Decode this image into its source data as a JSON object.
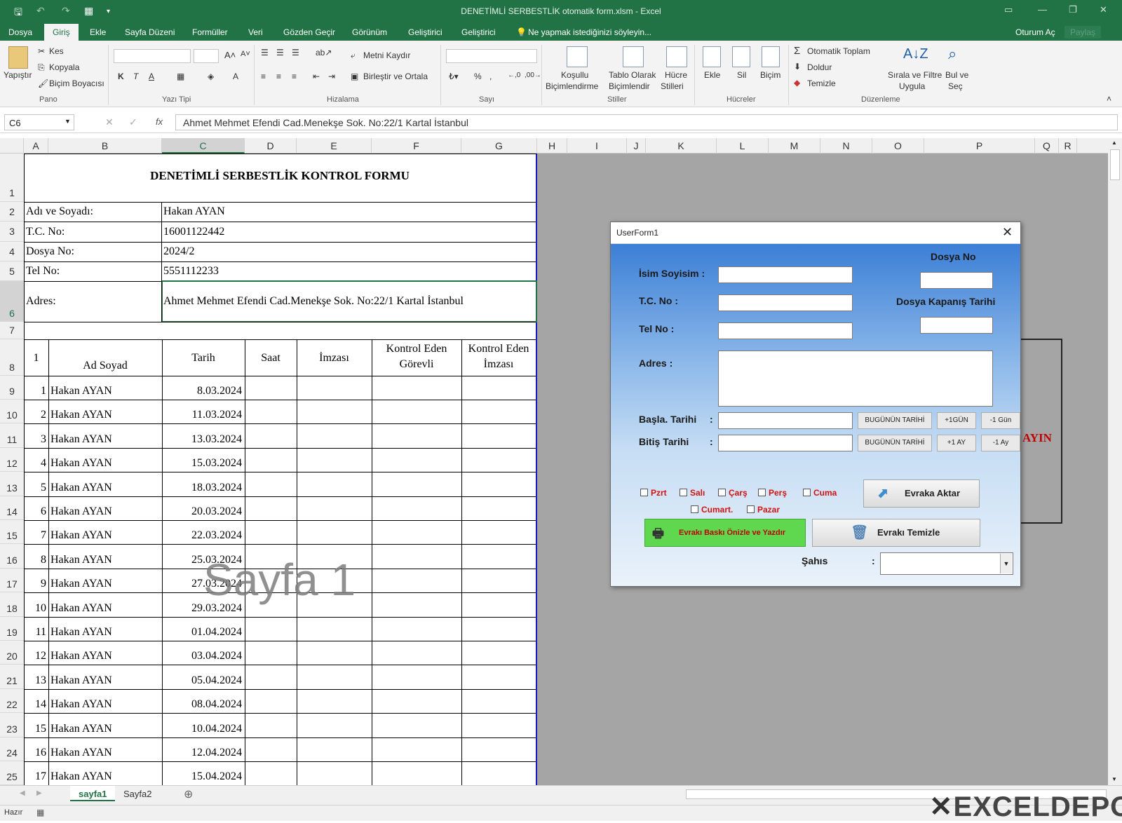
{
  "window": {
    "title": "DENETİMLİ SERBESTLİK otomatik form.xlsm - Excel",
    "sign_in": "Oturum Aç",
    "share": "Paylaş"
  },
  "menu": [
    "Dosya",
    "Giriş",
    "Ekle",
    "Sayfa Düzeni",
    "Formüller",
    "Veri",
    "Gözden Geçir",
    "Görünüm",
    "Geliştirici",
    "Geliştirici"
  ],
  "tell_me": "Ne yapmak istediğinizi söyleyin...",
  "ribbon": {
    "paste": "Yapıştır",
    "cut": "Kes",
    "copy": "Kopyala",
    "painter": "Biçim Boyacısı",
    "bold": "K",
    "italic": "T",
    "underline": "A",
    "wrap": "Metni Kaydır",
    "merge": "Birleştir ve Ortala",
    "percent": "%",
    "cond_format": [
      "Koşullu",
      "Biçimlendirme"
    ],
    "table_format": [
      "Tablo Olarak",
      "Biçimlendir"
    ],
    "cell_styles": [
      "Hücre",
      "Stilleri"
    ],
    "insert": "Ekle",
    "delete": "Sil",
    "format": "Biçim",
    "autosum": "Otomatik Toplam",
    "fill": "Doldur",
    "clear": "Temizle",
    "sort": [
      "Sırala ve Filtre",
      "Uygula"
    ],
    "find": [
      "Bul ve",
      "Seç"
    ],
    "groups": {
      "clipboard": "Pano",
      "font": "Yazı Tipi",
      "alignment": "Hizalama",
      "number": "Sayı",
      "styles": "Stiller",
      "cells": "Hücreler",
      "editing": "Düzenleme"
    }
  },
  "formula_bar": {
    "name_box": "C6",
    "fx": "fx",
    "value": "Ahmet Mehmet Efendi Cad.Menekşe Sok. No:22/1 Kartal İstanbul"
  },
  "columns": [
    "A",
    "B",
    "C",
    "D",
    "E",
    "F",
    "G",
    "H",
    "I",
    "J",
    "K",
    "L",
    "M",
    "N",
    "O",
    "P",
    "Q",
    "R"
  ],
  "rows": [
    "1",
    "2",
    "3",
    "4",
    "5",
    "6",
    "7",
    "8",
    "9",
    "10",
    "11",
    "12",
    "13",
    "14",
    "15",
    "16",
    "17",
    "18",
    "19",
    "20",
    "21",
    "22",
    "23",
    "24",
    "25"
  ],
  "sheet": {
    "title": "DENETİMLİ SERBESTLİK KONTROL FORMU",
    "info": [
      {
        "label": "Adı ve Soyadı:",
        "value": "Hakan AYAN"
      },
      {
        "label": "T.C. No:",
        "value": "16001122442"
      },
      {
        "label": "Dosya No:",
        "value": "2024/2"
      },
      {
        "label": "Tel No:",
        "value": "5551112233"
      },
      {
        "label": "Adres:",
        "value": "Ahmet Mehmet Efendi Cad.Menekşe Sok. No:22/1 Kartal İstanbul"
      }
    ],
    "headers": {
      "no": "1",
      "name": "Ad Soyad",
      "date": "Tarih",
      "time": "Saat",
      "sign": "İmzası",
      "officer": [
        "Kontrol Eden",
        "Görevli"
      ],
      "officer_sign": [
        "Kontrol Eden",
        "İmzası"
      ]
    },
    "records": [
      {
        "n": "1",
        "name": "Hakan AYAN",
        "date": "8.03.2024"
      },
      {
        "n": "2",
        "name": "Hakan AYAN",
        "date": "11.03.2024"
      },
      {
        "n": "3",
        "name": "Hakan AYAN",
        "date": "13.03.2024"
      },
      {
        "n": "4",
        "name": "Hakan AYAN",
        "date": "15.03.2024"
      },
      {
        "n": "5",
        "name": "Hakan AYAN",
        "date": "18.03.2024"
      },
      {
        "n": "6",
        "name": "Hakan AYAN",
        "date": "20.03.2024"
      },
      {
        "n": "7",
        "name": "Hakan AYAN",
        "date": "22.03.2024"
      },
      {
        "n": "8",
        "name": "Hakan AYAN",
        "date": "25.03.2024"
      },
      {
        "n": "9",
        "name": "Hakan AYAN",
        "date": "27.03.2024"
      },
      {
        "n": "10",
        "name": "Hakan AYAN",
        "date": "29.03.2024"
      },
      {
        "n": "11",
        "name": "Hakan AYAN",
        "date": "01.04.2024"
      },
      {
        "n": "12",
        "name": "Hakan AYAN",
        "date": "03.04.2024"
      },
      {
        "n": "13",
        "name": "Hakan AYAN",
        "date": "05.04.2024"
      },
      {
        "n": "14",
        "name": "Hakan AYAN",
        "date": "08.04.2024"
      },
      {
        "n": "15",
        "name": "Hakan AYAN",
        "date": "10.04.2024"
      },
      {
        "n": "16",
        "name": "Hakan AYAN",
        "date": "12.04.2024"
      },
      {
        "n": "17",
        "name": "Hakan AYAN",
        "date": "15.04.2024"
      }
    ],
    "watermark": "Sayfa 1",
    "side_text": "AYIN"
  },
  "userform": {
    "title": "UserForm1",
    "name_label": "İsim Soyisim :",
    "tc_label": "T.C. No :",
    "tel_label": "Tel No :",
    "address_label": "Adres :",
    "file_no_label": "Dosya No",
    "close_date_label": "Dosya Kapanış Tarihi",
    "start_label": "Başla. Tarihi",
    "end_label": "Bitiş   Tarihi",
    "colon": ":",
    "today": "BUGÜNÜN TARİHİ",
    "plus_day": "+1GÜN",
    "minus_day": "-1 Gün",
    "plus_month": "+1 AY",
    "minus_month": "-1 Ay",
    "days": [
      "Pzrt",
      "Salı",
      "Çarş",
      "Perş",
      "Cuma",
      "Cumart.",
      "Pazar"
    ],
    "transfer": "Evraka Aktar",
    "print": "Evrakı Baskı Önizle ve Yazdır",
    "clear": "Evrakı Temizle",
    "person_label": "Şahıs"
  },
  "tabs": [
    "sayfa1",
    "Sayfa2"
  ],
  "status": "Hazır",
  "logo": "EXCELDEPO",
  "colors": {
    "excel_green": "#217346",
    "red": "#c00000",
    "green_button": "#5fd84f"
  }
}
